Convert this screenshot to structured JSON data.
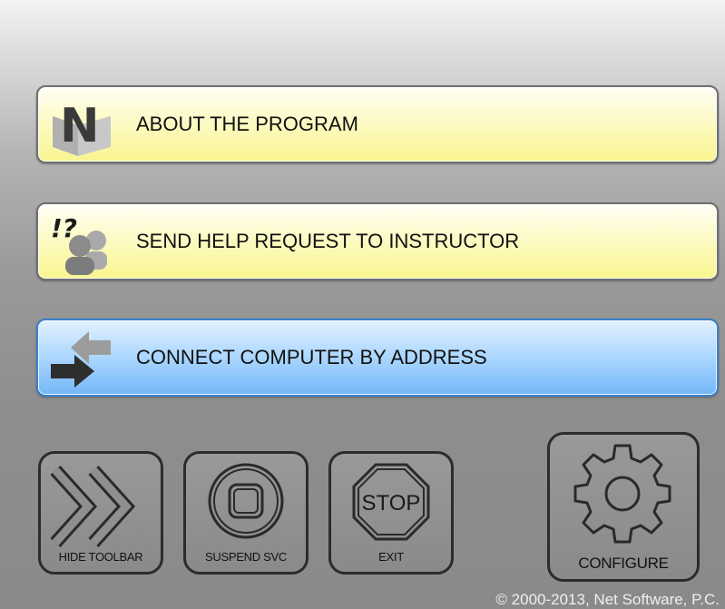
{
  "menu": {
    "about_label": "ABOUT THE PROGRAM",
    "help_request_label": "SEND HELP REQUEST TO INSTRUCTOR",
    "help_icon_text": "!?",
    "connect_label": "CONNECT COMPUTER BY ADDRESS",
    "logo_letter": "N"
  },
  "toolbar": {
    "hide_label": "HIDE TOOLBAR",
    "suspend_label": "SUSPEND SVC",
    "exit_label": "EXIT",
    "stop_sign_text": "STOP",
    "configure_label": "CONFIGURE"
  },
  "footer": {
    "copyright": "© 2000-2013, Net Software, P.C."
  },
  "colors": {
    "yellow_button": "#f9f58f",
    "blue_button": "#73b7f7",
    "tool_border": "#2c2c2c"
  },
  "icons": [
    "logo-n-icon",
    "help-request-icon",
    "connect-arrows-icon",
    "double-chevron-icon",
    "stop-square-icon",
    "stop-sign-icon",
    "gear-icon"
  ]
}
